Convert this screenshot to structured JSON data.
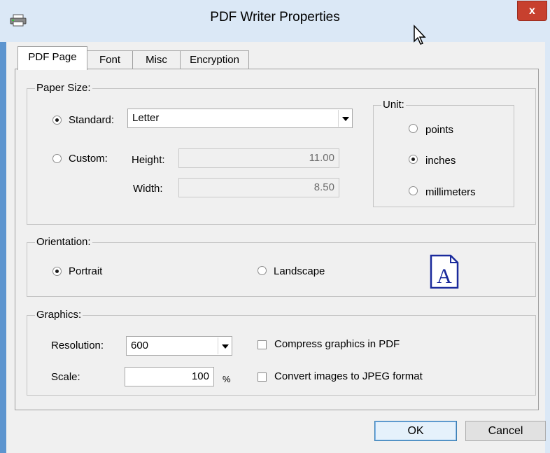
{
  "window": {
    "title": "PDF Writer Properties",
    "close_label": "x",
    "frame_color": "#5d95cf",
    "titlebar_color": "#dbe8f6"
  },
  "tabs": [
    {
      "label": "PDF Page",
      "active": true
    },
    {
      "label": "Font",
      "active": false
    },
    {
      "label": "Misc",
      "active": false
    },
    {
      "label": "Encryption",
      "active": false
    }
  ],
  "paper_size": {
    "group_label": "Paper Size:",
    "standard_label": "Standard:",
    "standard_selected": true,
    "standard_value": "Letter",
    "custom_label": "Custom:",
    "custom_selected": false,
    "height_label": "Height:",
    "height_value": "11.00",
    "width_label": "Width:",
    "width_value": "8.50"
  },
  "unit": {
    "group_label": "Unit:",
    "options": [
      {
        "label": "points",
        "selected": false
      },
      {
        "label": "inches",
        "selected": true
      },
      {
        "label": "millimeters",
        "selected": false
      }
    ]
  },
  "orientation": {
    "group_label": "Orientation:",
    "portrait_label": "Portrait",
    "portrait_selected": true,
    "landscape_label": "Landscape",
    "landscape_selected": false,
    "preview_letter": "A"
  },
  "graphics": {
    "group_label": "Graphics:",
    "resolution_label": "Resolution:",
    "resolution_value": "600",
    "scale_label": "Scale:",
    "scale_value": "100",
    "scale_unit": "%",
    "compress_label": "Compress graphics in PDF",
    "compress_checked": false,
    "jpeg_label": "Convert images to JPEG format",
    "jpeg_checked": false
  },
  "buttons": {
    "ok_label": "OK",
    "cancel_label": "Cancel"
  },
  "icons": {
    "app": "printer-icon",
    "cursor": "mouse-pointer-icon",
    "orientation_preview": "portrait-page-icon"
  }
}
